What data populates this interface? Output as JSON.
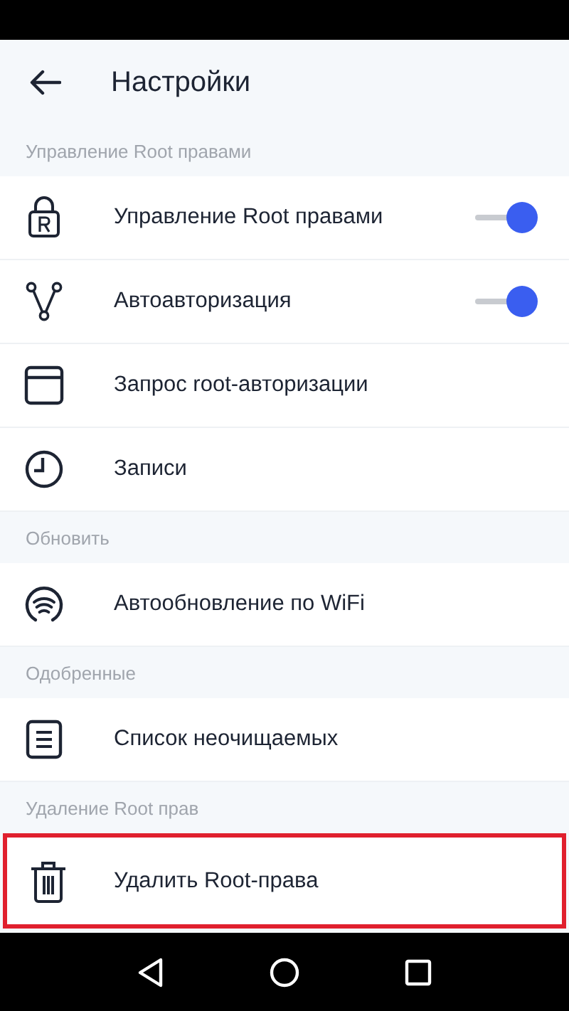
{
  "header": {
    "title": "Настройки"
  },
  "sections": [
    {
      "title": "Управление Root правами",
      "items": [
        {
          "label": "Управление Root правами",
          "kind": "toggle",
          "on": true,
          "highlighted": false
        },
        {
          "label": "Автоавторизация",
          "kind": "toggle",
          "on": true,
          "highlighted": false
        },
        {
          "label": "Запрос root-авторизации",
          "kind": "plain",
          "highlighted": false
        },
        {
          "label": "Записи",
          "kind": "plain",
          "highlighted": false
        }
      ]
    },
    {
      "title": "Обновить",
      "items": [
        {
          "label": "Автообновление по WiFi",
          "kind": "plain",
          "highlighted": false
        }
      ]
    },
    {
      "title": "Одобренные",
      "items": [
        {
          "label": "Список неочищаемых",
          "kind": "plain",
          "highlighted": false
        }
      ]
    },
    {
      "title": "Удаление Root прав",
      "items": [
        {
          "label": "Удалить Root-права",
          "kind": "plain",
          "highlighted": true
        }
      ]
    }
  ]
}
